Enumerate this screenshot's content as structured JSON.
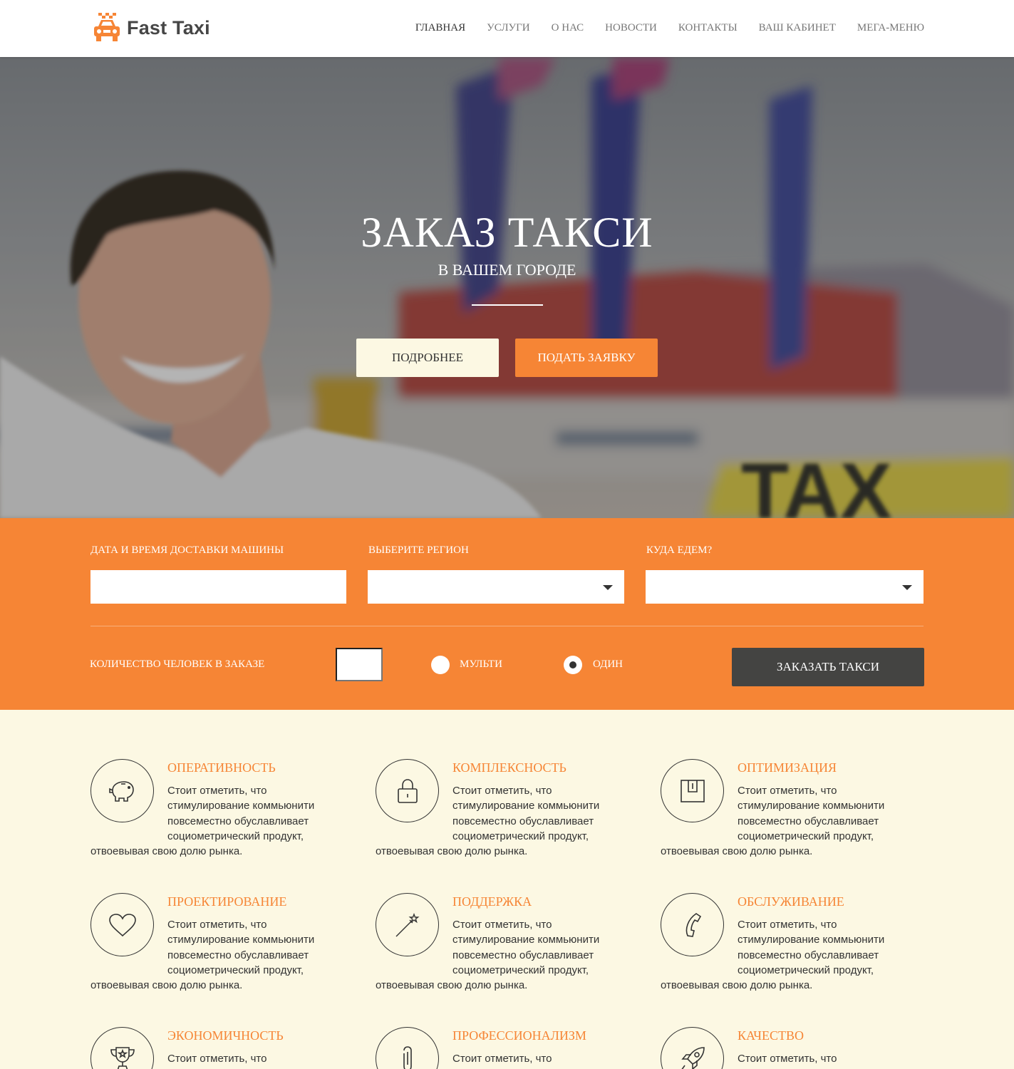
{
  "brand": {
    "name": "Fast Taxi",
    "accent": "#f68535",
    "cream": "#fcf8e3",
    "dark": "#444442"
  },
  "nav": {
    "items": [
      "ГЛАВНАЯ",
      "УСЛУГИ",
      "О НАС",
      "НОВОСТИ",
      "КОНТАКТЫ",
      "ВАШ КАБИНЕТ",
      "МЕГА-МЕНЮ"
    ]
  },
  "hero": {
    "title": "ЗАКАЗ ТАКСИ",
    "subtitle": "В ВАШЕМ ГОРОДЕ",
    "btn_more": "ПОДРОБНЕЕ",
    "btn_apply": "ПОДАТЬ ЗАЯВКУ"
  },
  "order": {
    "date_label": "ДАТА И ВРЕМЯ ДОСТАВКИ МАШИНЫ",
    "date_value": "",
    "region_label": "ВЫБЕРИТЕ РЕГИОН",
    "region_value": "",
    "dest_label": "КУДА ЕДЕМ?",
    "dest_value": "",
    "count_label": "КОЛИЧЕСТВО ЧЕЛОВЕК В ЗАКАЗЕ",
    "count_value": "",
    "radio_multi": "МУЛЬТИ",
    "radio_single": "ОДИН",
    "selected": "ОДИН",
    "submit": "ЗАКАЗАТЬ ТАКСИ"
  },
  "features": [
    {
      "title": "ОПЕРАТИВНОСТЬ",
      "icon": "piggy-bank-icon",
      "text": "Стоит отметить, что стимулирование коммьюнити повсеместно обуславливает социометрический продукт, отвоевывая свою долю рынка."
    },
    {
      "title": "КОМПЛЕКСНОСТЬ",
      "icon": "lock-icon",
      "text": "Стоит отметить, что стимулирование коммьюнити повсеместно обуславливает социометрический продукт, отвоевывая свою долю рынка."
    },
    {
      "title": "ОПТИМИЗАЦИЯ",
      "icon": "clipboard-icon",
      "text": "Стоит отметить, что стимулирование коммьюнити повсеместно обуславливает социометрический продукт, отвоевывая свою долю рынка."
    },
    {
      "title": "ПРОЕКТИРОВАНИЕ",
      "icon": "heart-icon",
      "text": "Стоит отметить, что стимулирование коммьюнити повсеместно обуславливает социометрический продукт, отвоевывая свою долю рынка."
    },
    {
      "title": "ПОДДЕРЖКА",
      "icon": "magic-wand-icon",
      "text": "Стоит отметить, что стимулирование коммьюнити повсеместно обуславливает социометрический продукт, отвоевывая свою долю рынка."
    },
    {
      "title": "ОБСЛУЖИВАНИЕ",
      "icon": "phone-icon",
      "text": "Стоит отметить, что стимулирование коммьюнити повсеместно обуславливает социометрический продукт, отвоевывая свою долю рынка."
    },
    {
      "title": "ЭКОНОМИЧНОСТЬ",
      "icon": "trophy-icon",
      "text": "Стоит отметить, что"
    },
    {
      "title": "ПРОФЕССИОНАЛИЗМ",
      "icon": "paperclip-icon",
      "text": "Стоит отметить, что"
    },
    {
      "title": "КАЧЕСТВО",
      "icon": "rocket-icon",
      "text": "Стоит отметить, что"
    }
  ]
}
